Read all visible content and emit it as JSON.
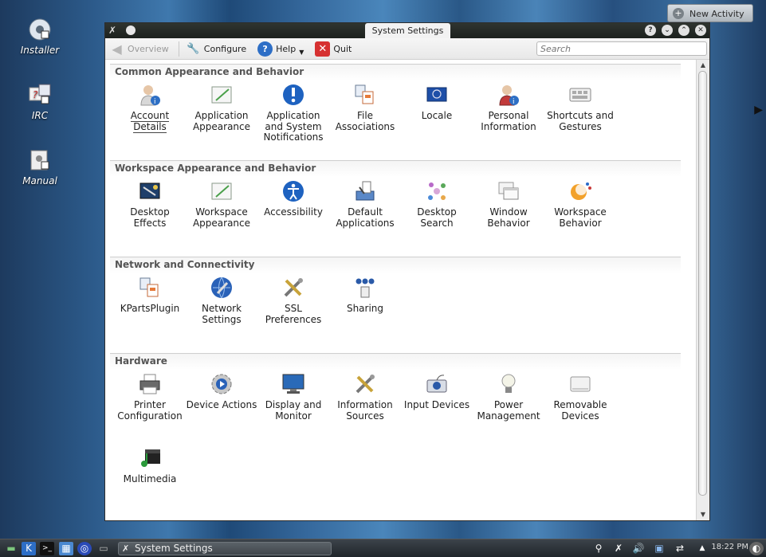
{
  "desktop": {
    "icons": [
      {
        "label": "Installer",
        "icon": "installer-icon"
      },
      {
        "label": "IRC",
        "icon": "irc-icon"
      },
      {
        "label": "Manual",
        "icon": "manual-icon"
      }
    ],
    "new_activity": "New Activity"
  },
  "window": {
    "title": "System Settings",
    "toolbar": {
      "overview": "Overview",
      "configure": "Configure",
      "help": "Help",
      "quit": "Quit",
      "search_placeholder": "Search"
    },
    "sections": [
      {
        "title": "Common Appearance and Behavior",
        "items": [
          {
            "label": "Account Details",
            "icon": "account-icon"
          },
          {
            "label": "Application Appearance",
            "icon": "appearance-icon"
          },
          {
            "label": "Application and System Notifications",
            "icon": "notifications-icon"
          },
          {
            "label": "File Associations",
            "icon": "file-associations-icon"
          },
          {
            "label": "Locale",
            "icon": "locale-icon"
          },
          {
            "label": "Personal Information",
            "icon": "personal-info-icon"
          },
          {
            "label": "Shortcuts and Gestures",
            "icon": "shortcuts-icon"
          }
        ]
      },
      {
        "title": "Workspace Appearance and Behavior",
        "items": [
          {
            "label": "Desktop Effects",
            "icon": "desktop-effects-icon"
          },
          {
            "label": "Workspace Appearance",
            "icon": "workspace-appearance-icon"
          },
          {
            "label": "Accessibility",
            "icon": "accessibility-icon"
          },
          {
            "label": "Default Applications",
            "icon": "default-apps-icon"
          },
          {
            "label": "Desktop Search",
            "icon": "desktop-search-icon"
          },
          {
            "label": "Window Behavior",
            "icon": "window-behavior-icon"
          },
          {
            "label": "Workspace Behavior",
            "icon": "workspace-behavior-icon"
          }
        ]
      },
      {
        "title": "Network and Connectivity",
        "items": [
          {
            "label": "KPartsPlugin",
            "icon": "kparts-plugin-icon"
          },
          {
            "label": "Network Settings",
            "icon": "network-settings-icon"
          },
          {
            "label": "SSL Preferences",
            "icon": "ssl-icon"
          },
          {
            "label": "Sharing",
            "icon": "sharing-icon"
          }
        ]
      },
      {
        "title": "Hardware",
        "items": [
          {
            "label": "Printer Configuration",
            "icon": "printer-icon"
          },
          {
            "label": "Device Actions",
            "icon": "device-actions-icon"
          },
          {
            "label": "Display and Monitor",
            "icon": "display-icon"
          },
          {
            "label": "Information Sources",
            "icon": "info-sources-icon"
          },
          {
            "label": "Input Devices",
            "icon": "input-devices-icon"
          },
          {
            "label": "Power Management",
            "icon": "power-icon"
          },
          {
            "label": "Removable Devices",
            "icon": "removable-icon"
          },
          {
            "label": "Multimedia",
            "icon": "multimedia-icon"
          }
        ]
      }
    ]
  },
  "taskbar": {
    "task_label": "System Settings",
    "clock": "18:22 PM"
  }
}
